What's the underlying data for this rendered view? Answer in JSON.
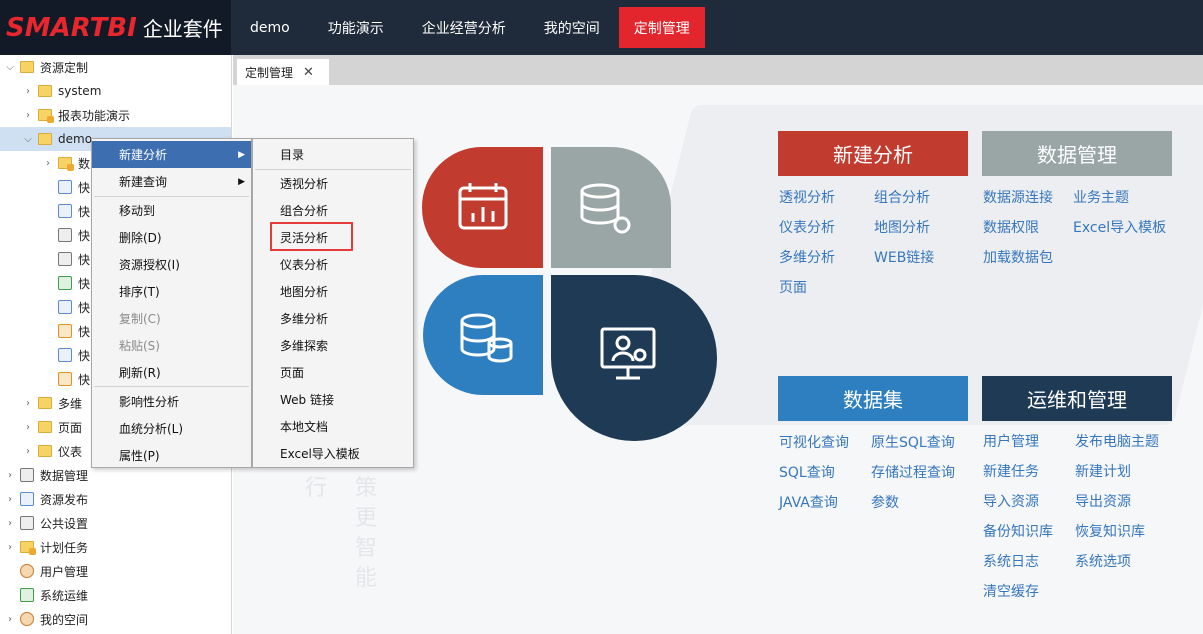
{
  "header": {
    "brand": "SMARTBI",
    "suite": "企业套件",
    "nav": [
      {
        "label": "demo"
      },
      {
        "label": "功能演示"
      },
      {
        "label": "企业经营分析"
      },
      {
        "label": "我的空间"
      },
      {
        "label": "定制管理"
      }
    ]
  },
  "sidebar": {
    "items": [
      {
        "label": "资源定制"
      },
      {
        "label": "system"
      },
      {
        "label": "报表功能演示"
      },
      {
        "label": "demo"
      },
      {
        "label": "数"
      },
      {
        "label": "快"
      },
      {
        "label": "快"
      },
      {
        "label": "快"
      },
      {
        "label": "快"
      },
      {
        "label": "快"
      },
      {
        "label": "快"
      },
      {
        "label": "快"
      },
      {
        "label": "快"
      },
      {
        "label": "快"
      },
      {
        "label": "多维"
      },
      {
        "label": "页面"
      },
      {
        "label": "仪表"
      },
      {
        "label": "数据管理"
      },
      {
        "label": "资源发布"
      },
      {
        "label": "公共设置"
      },
      {
        "label": "计划任务"
      },
      {
        "label": "用户管理"
      },
      {
        "label": "系统运维"
      },
      {
        "label": "我的空间"
      }
    ]
  },
  "tab": {
    "label": "定制管理",
    "close": "✕"
  },
  "context_menu": {
    "items": [
      {
        "label": "新建分析"
      },
      {
        "label": "新建查询"
      },
      {
        "label": "移动到"
      },
      {
        "label": "删除(D)"
      },
      {
        "label": "资源授权(I)"
      },
      {
        "label": "排序(T)"
      },
      {
        "label": "复制(C)"
      },
      {
        "label": "粘贴(S)"
      },
      {
        "label": "刷新(R)"
      },
      {
        "label": "影响性分析"
      },
      {
        "label": "血统分析(L)"
      },
      {
        "label": "属性(P)"
      }
    ]
  },
  "submenu": {
    "items": [
      {
        "label": "目录"
      },
      {
        "label": "透视分析"
      },
      {
        "label": "组合分析"
      },
      {
        "label": "灵活分析"
      },
      {
        "label": "仪表分析"
      },
      {
        "label": "地图分析"
      },
      {
        "label": "多维分析"
      },
      {
        "label": "多维探索"
      },
      {
        "label": "页面"
      },
      {
        "label": "Web 链接"
      },
      {
        "label": "本地文档"
      },
      {
        "label": "Excel导入模板"
      }
    ]
  },
  "cards": {
    "new_analysis": {
      "title": "新建分析",
      "color": "#c23b2f",
      "links": [
        "透视分析",
        "组合分析",
        "仪表分析",
        "地图分析",
        "多维分析",
        "WEB链接",
        "页面"
      ]
    },
    "data_management": {
      "title": "数据管理",
      "color": "#9aa5a6",
      "links": [
        "数据源连接",
        "业务主题",
        "数据权限",
        "Excel导入模板",
        "加载数据包"
      ]
    },
    "dataset": {
      "title": "数据集",
      "color": "#2e7fc0",
      "links": [
        "可视化查询",
        "原生SQL查询",
        "SQL查询",
        "存储过程查询",
        "JAVA查询",
        "参数"
      ]
    },
    "ops": {
      "title": "运维和管理",
      "color": "#1e3a55",
      "links": [
        "用户管理",
        "发布电脑主题",
        "新建任务",
        "新建计划",
        "导入资源",
        "导出资源",
        "备份知识库",
        "恢复知识库",
        "系统日志",
        "系统选项",
        "清空缓存"
      ]
    }
  },
  "background_text": [
    "行",
    "策",
    "更",
    "智",
    "能"
  ],
  "colors": {
    "header_bg": "#1f2a3a",
    "active_nav": "#e3262d",
    "link": "#3777bd",
    "menu_highlight": "#3d6fb0"
  }
}
